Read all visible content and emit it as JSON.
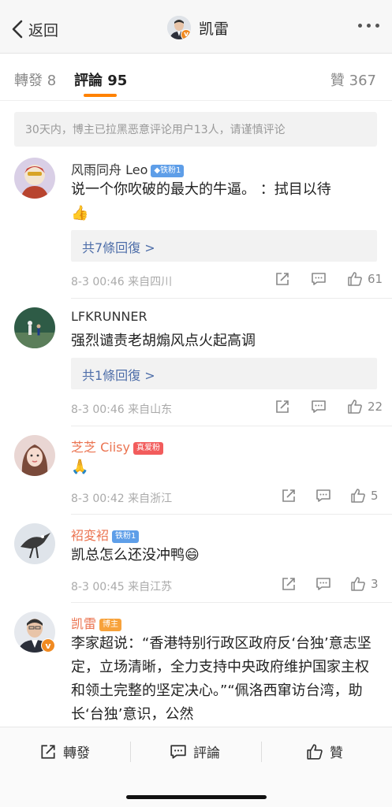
{
  "nav": {
    "back_label": "返回",
    "title": "凯雷",
    "verified_mark": "v"
  },
  "tabs": {
    "reposts": "轉發 8",
    "comments": "評論 95",
    "likes": "贊 367"
  },
  "notice": "30天内，博主已拉黑恶意评论用户13人，请谨慎评论",
  "comments": [
    {
      "name": "风雨同舟 Leo",
      "badge": "◆铁粉1",
      "text": "说一个你吹破的最大的牛逼。  ：拭目以待",
      "emoji": "👍",
      "replies": "共7條回復 >",
      "time": "8-3 00:46",
      "source": "来自四川",
      "likes": "61"
    },
    {
      "name": "LFKRUNNER",
      "text": "强烈谴责老胡煽风点火起高调",
      "replies": "共1條回復 >",
      "time": "8-3 00:46",
      "source": "来自山东",
      "likes": "22"
    },
    {
      "name": "芝芝 Ciisy",
      "badge": "真爱粉",
      "emoji": "🙏",
      "time": "8-3 00:42",
      "source": "来自浙江",
      "likes": "5"
    },
    {
      "name": "袑変袑",
      "badge": "铁粉1",
      "text": "凯总怎么还没冲鸭",
      "emoji": "😄",
      "time": "8-3 00:45",
      "source": "来自江苏",
      "likes": "3"
    },
    {
      "name": "凯雷",
      "badge": "博主",
      "text": "李家超说：“香港特别行政区政府反‘台独’意志坚定，立场清晰，全力支持中央政府维护国家主权和领土完整的坚定决心。”“佩洛西窜访台湾，助长‘台独’意识，公然"
    }
  ],
  "bottombar": {
    "repost": "轉發",
    "comment": "評論",
    "like": "贊"
  },
  "colors": {
    "accent": "#ff8200",
    "link": "#4e6ea9",
    "vip_name": "#eb7350"
  }
}
